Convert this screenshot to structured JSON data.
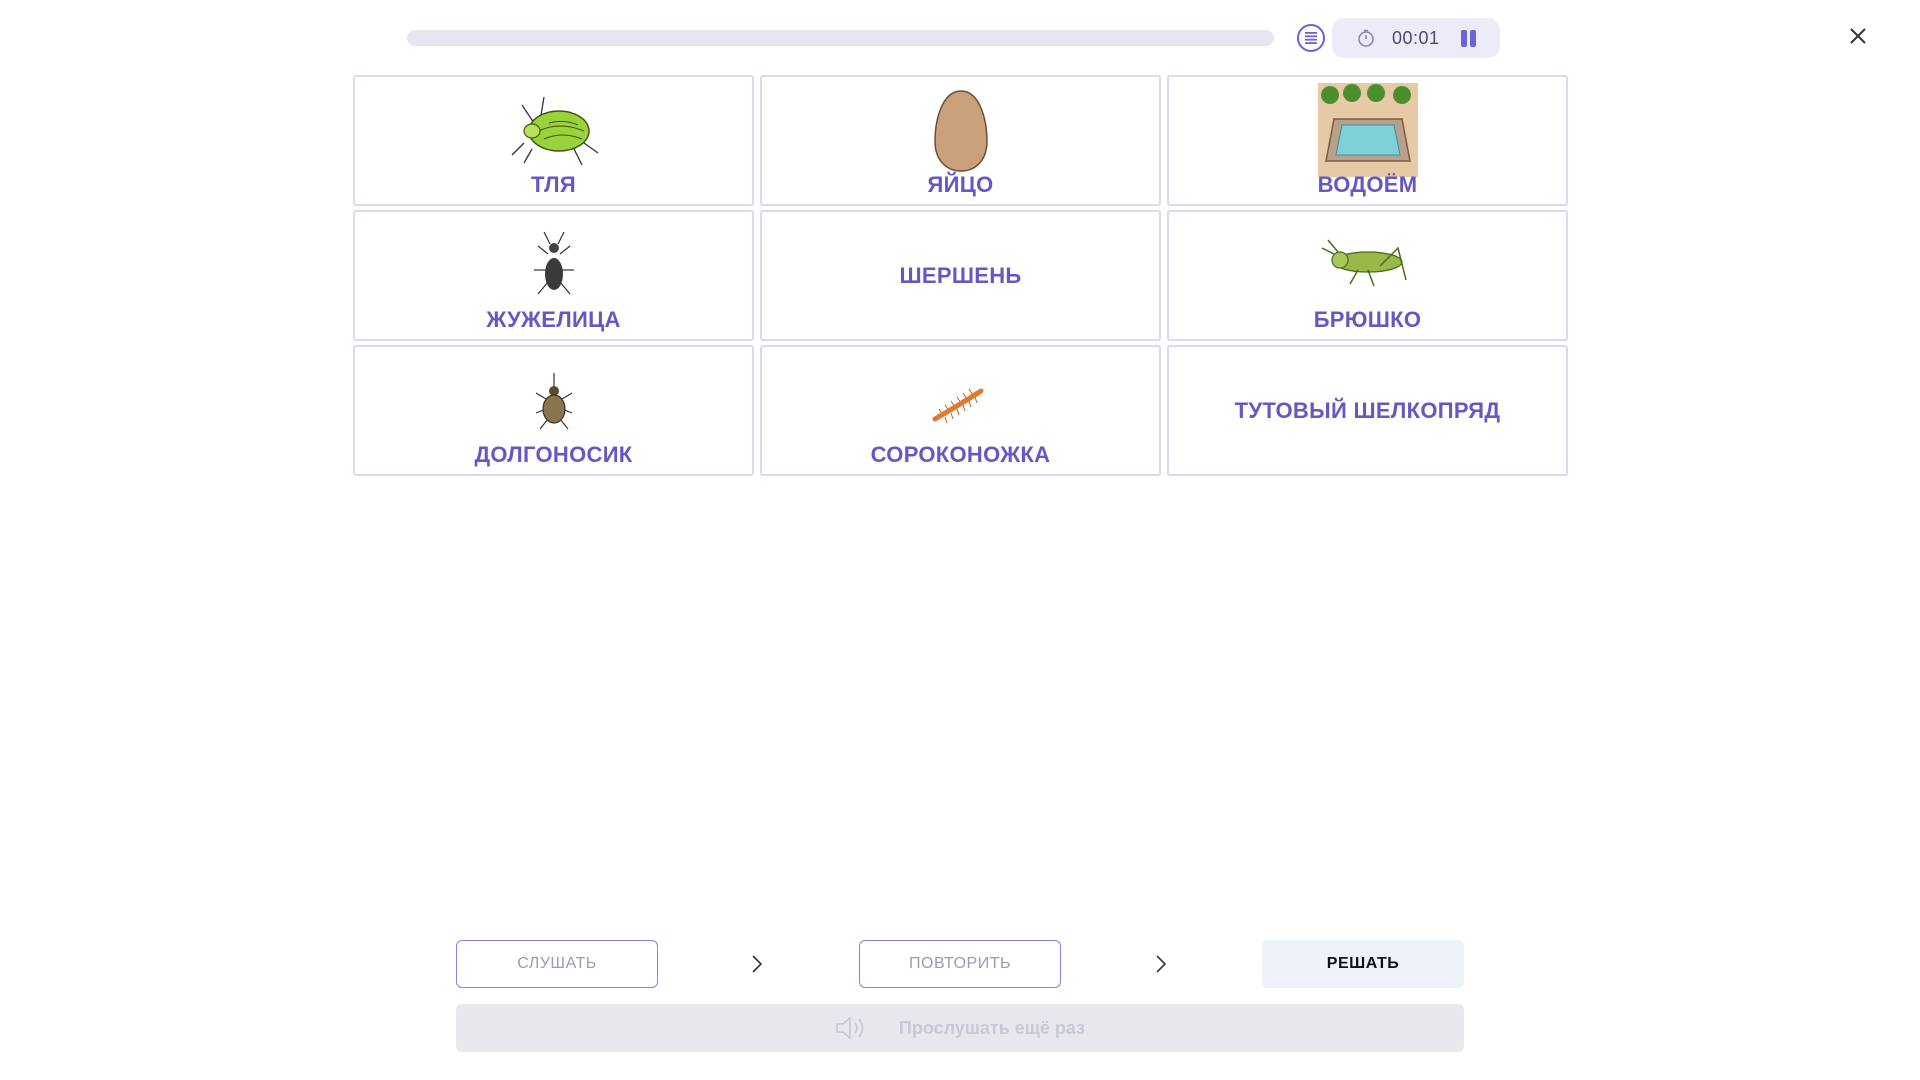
{
  "header": {
    "progress_percent": 0,
    "timer": "00:01",
    "icons": {
      "list": "list-icon",
      "timer": "stopwatch-icon",
      "pause": "pause-icon",
      "close": "close-icon"
    }
  },
  "cards": [
    {
      "label": "ТЛЯ",
      "picture": "aphid"
    },
    {
      "label": "ЯЙЦО",
      "picture": "egg"
    },
    {
      "label": "ВОДОЁМ",
      "picture": "pond"
    },
    {
      "label": "ЖУЖЕЛИЦА",
      "picture": "ground-beetle"
    },
    {
      "label": "ШЕРШЕНЬ",
      "picture": ""
    },
    {
      "label": "БРЮШКО",
      "picture": "grasshopper"
    },
    {
      "label": "ДОЛГОНОСИК",
      "picture": "weevil"
    },
    {
      "label": "СОРОКОНОЖКА",
      "picture": "centipede"
    },
    {
      "label": "ТУТОВЫЙ ШЕЛКОПРЯД",
      "picture": ""
    }
  ],
  "steps": {
    "listen": "СЛУШАТЬ",
    "repeat": "ПОВТОРИТЬ",
    "solve": "РЕШАТЬ"
  },
  "replay": {
    "label": "Прослушать ещё раз",
    "icon": "speaker-icon"
  },
  "colors": {
    "accent": "#6c63d6",
    "card_label": "#6658c4",
    "card_border": "#d9d9ef"
  }
}
